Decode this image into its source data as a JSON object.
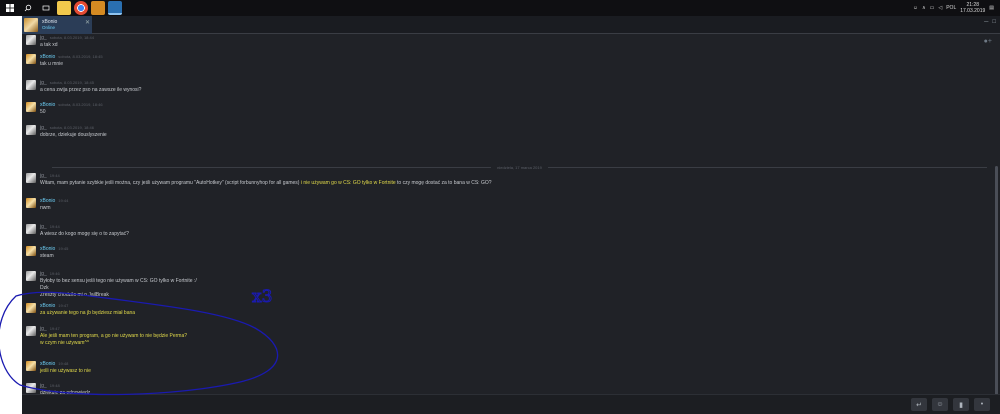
{
  "taskbar": {
    "apps": [
      {
        "icon": "file-explorer-icon",
        "color": "#f2c94c"
      },
      {
        "icon": "chrome-icon",
        "color": "#e34a33"
      },
      {
        "icon": "game-icon",
        "color": "#d58a22"
      },
      {
        "icon": "steam-icon",
        "color": "#2a6fb0"
      }
    ],
    "lang": "POL",
    "time": "21:28",
    "date": "17.03.2019"
  },
  "tab": {
    "name": "xBonio",
    "status": "Online"
  },
  "divider": {
    "date": "niedziela, 17 marca 2019"
  },
  "messages": [
    {
      "sender": "jg_",
      "who": "me",
      "time": "sobota, 8.03.2019, 18:44",
      "lines": [
        "a tak xd"
      ]
    },
    {
      "sender": "xBonio",
      "who": "xb",
      "time": "sobota, 8.03.2019, 18:45",
      "lines": [
        "tak u mnie"
      ]
    },
    {
      "sender": "jg_",
      "who": "me",
      "time": "sobota, 8.03.2019, 18:45",
      "lines": [
        "a cena zwija przez pso na zawsze ile wynosi?"
      ]
    },
    {
      "sender": "xBonio",
      "who": "xb",
      "time": "sobota, 8.03.2019, 18:46",
      "lines": [
        "50"
      ]
    },
    {
      "sender": "jg_",
      "who": "me",
      "time": "sobota, 8.03.2019, 18:46",
      "lines": [
        "dobrze, dziekuje douslyszenie"
      ]
    },
    {
      "sender": "jg_",
      "who": "me",
      "time": "19:44",
      "segments": [
        {
          "t": "Witam, mam pytanie szybkie jeśli można, czy jeśli używam programu \"AutoHotkey\" (script forbunnyhop for all games) "
        },
        {
          "t": "i nie używam go w CS: GO tylko w Fortnite",
          "hl": true
        },
        {
          "t": " to czy mogę dostać za to bana w CS: GO?"
        }
      ]
    },
    {
      "sender": "xBonio",
      "who": "xb",
      "time": "19:44",
      "lines": [
        "nwm"
      ]
    },
    {
      "sender": "jg_",
      "who": "me",
      "time": "19:44",
      "lines": [
        "A wiesz do kogo mogę się o to zapytać?"
      ]
    },
    {
      "sender": "xBonio",
      "who": "xb",
      "time": "19:45",
      "lines": [
        "steam"
      ]
    },
    {
      "sender": "jg_",
      "who": "me",
      "time": "19:46",
      "lines": [
        "Byłoby to bez sensu jeśli tego nie używam w CS: GO tylko w Fortnite :/",
        "Dzk",
        "Zreszty chodziło mi o JailBreak"
      ]
    },
    {
      "sender": "xBonio",
      "who": "xb",
      "time": "19:47",
      "hl": true,
      "lines": [
        "za używanie tego na jb będziesz miał bana"
      ]
    },
    {
      "sender": "jg_",
      "who": "me",
      "time": "19:47",
      "hl": true,
      "lines": [
        "Ale jeśli mam ten program, a go nie używam to nie będzie Perma?",
        "w czym nie używam^^"
      ]
    },
    {
      "sender": "xBonio",
      "who": "xb",
      "time": "19:48",
      "hl": true,
      "lines": [
        "jeśli nie używasz to nie"
      ]
    },
    {
      "sender": "jg_",
      "who": "me",
      "time": "19:48",
      "lines": [
        "dziekuje za odpowiedz"
      ]
    }
  ],
  "annotation": {
    "text": "x3",
    "ink_color": "#1a1ab0"
  },
  "colors": {
    "window_bg": "#202227",
    "friend_name": "#6dcff6",
    "highlight_text": "#e0d94a"
  }
}
